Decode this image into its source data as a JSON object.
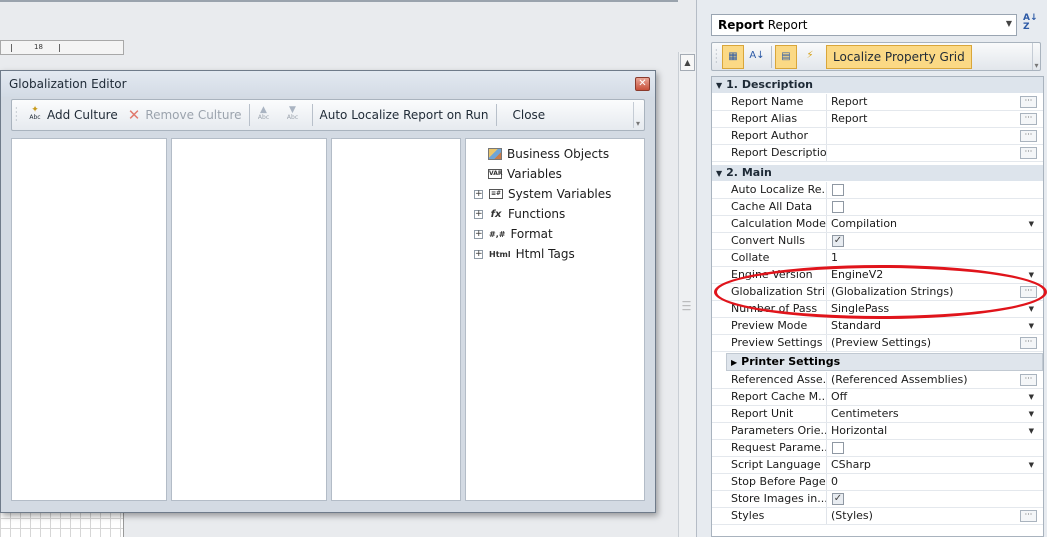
{
  "designer": {
    "ruler_number": "18"
  },
  "glob_editor": {
    "title": "Globalization Editor",
    "toolbar": {
      "add_culture": "Add Culture",
      "remove_culture": "Remove Culture",
      "auto_localize": "Auto Localize Report on Run",
      "close": "Close",
      "abc_icon_text": "Abc"
    },
    "tree": [
      {
        "label": "Business Objects",
        "icon": "business-objects-icon",
        "expander": false
      },
      {
        "label": "Variables",
        "icon": "variables-icon",
        "expander": false
      },
      {
        "label": "System Variables",
        "icon": "system-variables-icon",
        "expander": true
      },
      {
        "label": "Functions",
        "icon": "functions-icon",
        "expander": true
      },
      {
        "label": "Format",
        "icon": "format-icon",
        "expander": true
      },
      {
        "label": "Html Tags",
        "icon": "html-tags-icon",
        "expander": true
      }
    ],
    "icon_text": {
      "variables": "VAR",
      "functions": "fx",
      "format": "#,#",
      "html": "Html"
    }
  },
  "property_grid": {
    "object_combo_bold": "Report",
    "object_combo_rest": "Report",
    "localize_button": "Localize Property Grid",
    "categories": [
      {
        "label": "1. Description",
        "rows": [
          {
            "name": "Report Name",
            "value": "Report",
            "editor": "ellipsis"
          },
          {
            "name": "Report Alias",
            "value": "Report",
            "editor": "ellipsis"
          },
          {
            "name": "Report Author",
            "value": "",
            "editor": "ellipsis"
          },
          {
            "name": "Report Description",
            "value": "",
            "editor": "ellipsis"
          }
        ]
      },
      {
        "label": "2. Main",
        "rows": [
          {
            "name": "Auto Localize Re...",
            "value": "",
            "editor": "checkbox",
            "checked": false
          },
          {
            "name": "Cache All Data",
            "value": "",
            "editor": "checkbox",
            "checked": false
          },
          {
            "name": "Calculation Mode",
            "value": "Compilation",
            "editor": "dropdown"
          },
          {
            "name": "Convert Nulls",
            "value": "",
            "editor": "checkbox",
            "checked": true
          },
          {
            "name": "Collate",
            "value": "1",
            "editor": "none"
          },
          {
            "name": "Engine Version",
            "value": "EngineV2",
            "editor": "dropdown"
          },
          {
            "name": "Globalization Stri...",
            "value": "(Globalization Strings)",
            "editor": "ellipsis"
          },
          {
            "name": "Number of Pass",
            "value": "SinglePass",
            "editor": "dropdown"
          },
          {
            "name": "Preview Mode",
            "value": "Standard",
            "editor": "dropdown"
          },
          {
            "name": "Preview Settings",
            "value": "(Preview Settings)",
            "editor": "ellipsis"
          }
        ],
        "subcategory": "Printer Settings",
        "rows_after": [
          {
            "name": "Referenced Asse...",
            "value": "(Referenced Assemblies)",
            "editor": "ellipsis"
          },
          {
            "name": "Report Cache M...",
            "value": "Off",
            "editor": "dropdown"
          },
          {
            "name": "Report Unit",
            "value": "Centimeters",
            "editor": "dropdown"
          },
          {
            "name": "Parameters Orie...",
            "value": "Horizontal",
            "editor": "dropdown"
          },
          {
            "name": "Request Parame...",
            "value": "",
            "editor": "checkbox",
            "checked": false
          },
          {
            "name": "Script Language",
            "value": "CSharp",
            "editor": "dropdown"
          },
          {
            "name": "Stop Before Page",
            "value": "0",
            "editor": "none"
          },
          {
            "name": "Store Images in...",
            "value": "",
            "editor": "checkbox",
            "checked": true
          },
          {
            "name": "Styles",
            "value": "(Styles)",
            "editor": "ellipsis"
          }
        ]
      }
    ]
  },
  "annotation": {
    "color": "#e0141b",
    "shape": "ellipse"
  }
}
